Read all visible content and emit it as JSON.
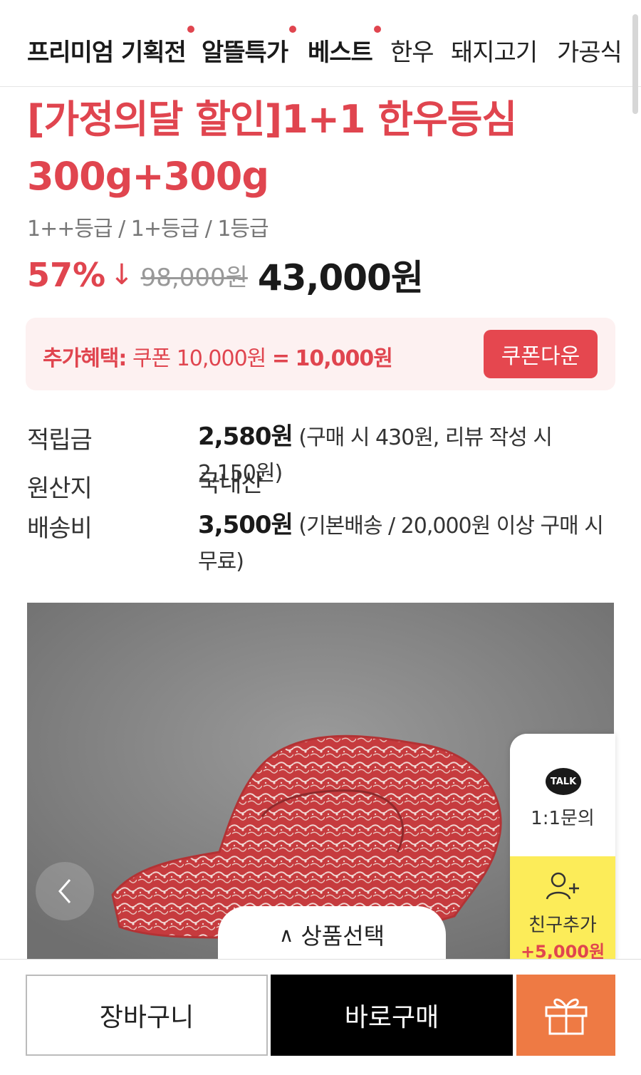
{
  "nav": {
    "items": [
      {
        "label": "프리미엄 기획전",
        "dot": true
      },
      {
        "label": "알뜰특가",
        "dot": true
      },
      {
        "label": "베스트",
        "dot": true
      },
      {
        "label": "한우",
        "dot": false
      },
      {
        "label": "돼지고기",
        "dot": false
      },
      {
        "label": "가공식",
        "dot": false
      }
    ]
  },
  "product": {
    "title_line1": "[가정의달 할인]1+1 한우등심",
    "title_line2": "300g+300g",
    "grade": "1++등급 / 1+등급 / 1등급",
    "discount": "57%",
    "discount_arrow": "↓",
    "original_price": "98,000원",
    "sale_price": "43,000원"
  },
  "benefit": {
    "label": "추가혜택:",
    "coupon_text": "쿠폰 10,000원",
    "equals": "=",
    "total": "10,000원",
    "button": "쿠폰다운"
  },
  "info": {
    "points_label": "적립금",
    "points_value": "2,580원",
    "points_detail": "(구매 시 430원, 리뷰 작성 시 2,150원)",
    "origin_label": "원산지",
    "origin_value": "국내산",
    "shipping_label": "배송비",
    "shipping_value": "3,500원",
    "shipping_detail": "(기본배송 / 20,000원 이상 구매 시 무료)"
  },
  "image": {
    "select_label": "상품선택",
    "caret": "∧"
  },
  "side": {
    "talk_icon": "TALK",
    "inquiry_label": "1:1문의",
    "friend_label": "친구추가",
    "friend_reward": "+5,000원"
  },
  "bottom": {
    "cart": "장바구니",
    "buy": "바로구매",
    "gift_icon": "gift-icon"
  },
  "colors": {
    "accent": "#e0454f",
    "gift": "#ee7a44",
    "friend_bg": "#fcec59"
  }
}
